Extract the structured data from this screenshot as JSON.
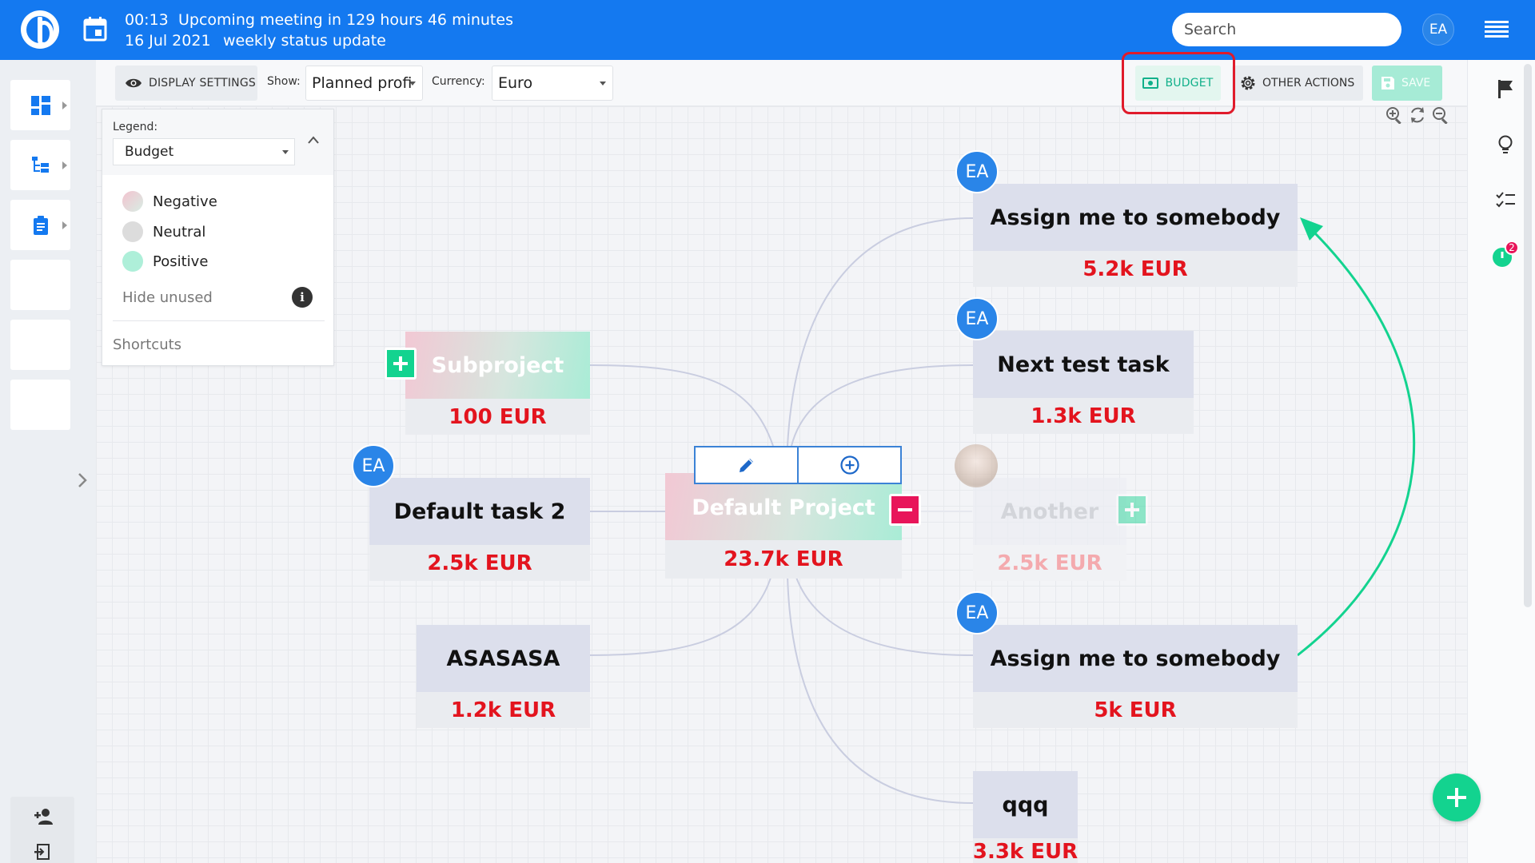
{
  "header": {
    "meeting_time": "00:13",
    "meeting_text": "Upcoming meeting in 129 hours 46 minutes",
    "meeting_date": "16 Jul 2021",
    "meeting_name": "weekly status update",
    "search_placeholder": "Search",
    "user_initials": "EA"
  },
  "toolbar": {
    "display_settings": "DISPLAY SETTINGS",
    "show_label": "Show:",
    "show_value": "Planned profi",
    "currency_label": "Currency:",
    "currency_value": "Euro",
    "budget": "BUDGET",
    "other_actions": "OTHER ACTIONS",
    "save": "SAVE"
  },
  "legend": {
    "title": "Legend:",
    "selected": "Budget",
    "items": [
      {
        "label": "Negative",
        "color": "#f0c8d2"
      },
      {
        "label": "Neutral",
        "color": "#dcdcdc"
      },
      {
        "label": "Positive",
        "color": "#aeefd9"
      }
    ],
    "hide_unused": "Hide unused",
    "shortcuts": "Shortcuts"
  },
  "nodes": {
    "root": {
      "title": "Default Project",
      "amount": "23.7k EUR"
    },
    "subproject": {
      "title": "Subproject",
      "amount": "100 EUR"
    },
    "task2": {
      "title": "Default task 2",
      "amount": "2.5k EUR",
      "assignee": "EA"
    },
    "asasasa": {
      "title": "ASASASA",
      "amount": "1.2k EUR"
    },
    "assign1": {
      "title": "Assign me to somebody",
      "amount": "5.2k EUR",
      "assignee": "EA"
    },
    "nexttest": {
      "title": "Next test task",
      "amount": "1.3k EUR",
      "assignee": "EA"
    },
    "another": {
      "title": "Another",
      "amount": "2.5k EUR"
    },
    "assign2": {
      "title": "Assign me to somebody",
      "amount": "5k EUR",
      "assignee": "EA"
    },
    "qqq": {
      "title": "qqq",
      "amount": "3.3k EUR"
    }
  },
  "right_sidebar": {
    "timer_badge": "2"
  },
  "colors": {
    "brand": "#1479f0",
    "accent": "#13d38f",
    "negative_amount": "#e3141e",
    "highlight": "#e01b2b"
  }
}
